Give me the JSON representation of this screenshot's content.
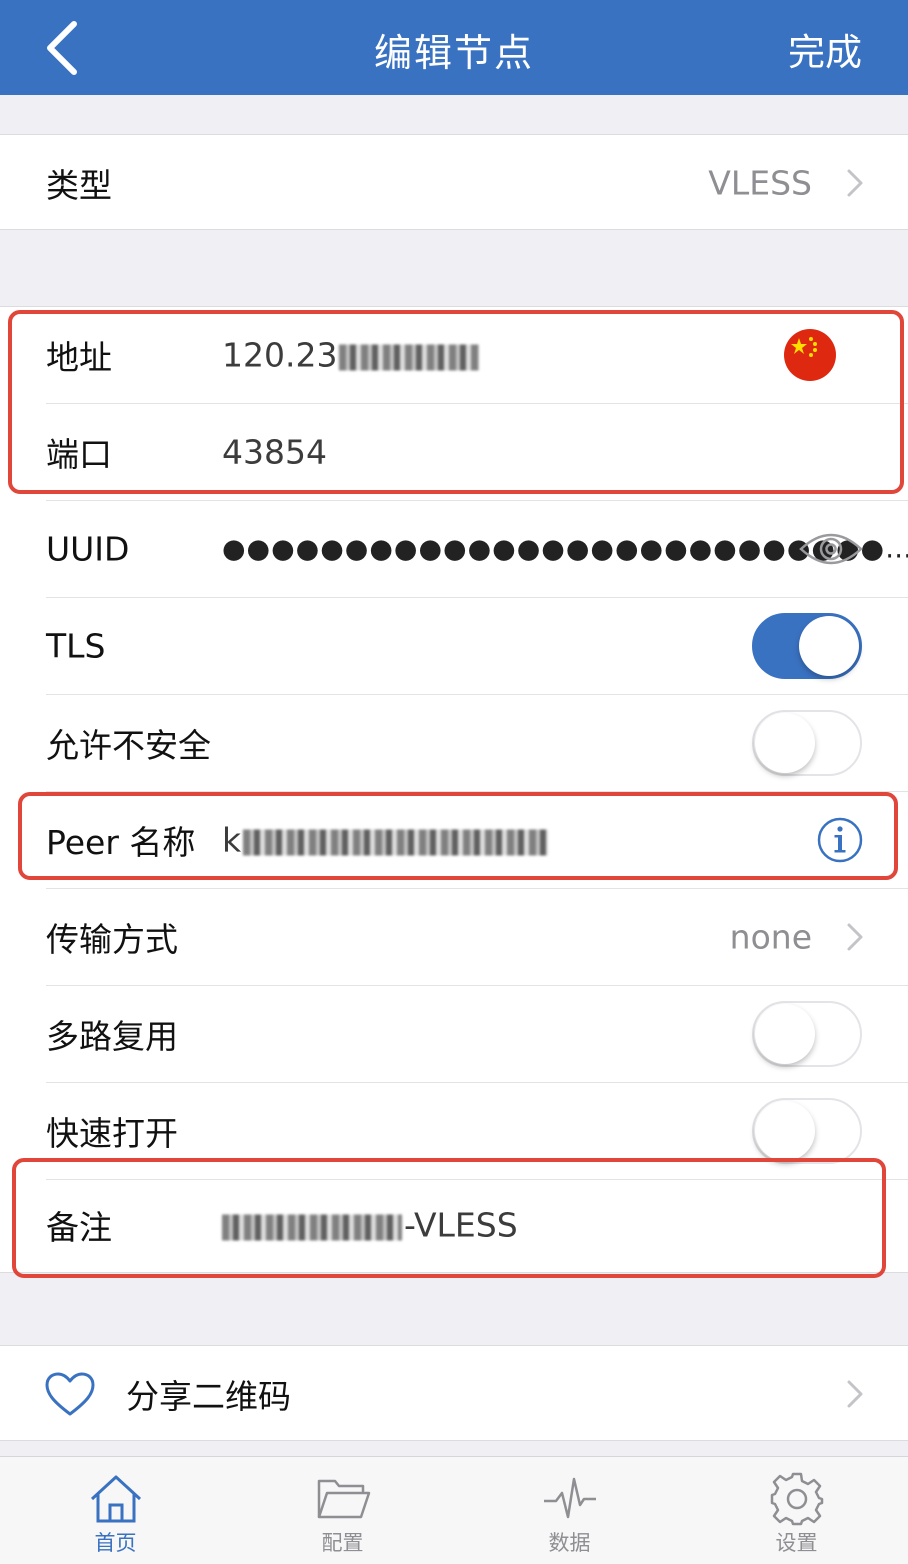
{
  "nav": {
    "title": "编辑节点",
    "done": "完成"
  },
  "type_row": {
    "label": "类型",
    "value": "VLESS"
  },
  "address": {
    "label": "地址",
    "value_visible": "120.23",
    "flag": "china-flag-icon"
  },
  "port": {
    "label": "端口",
    "value": "43854"
  },
  "uuid": {
    "label": "UUID",
    "value": "●●●●●●●●●●●●●●●●●●●●●●●●●●●…"
  },
  "tls": {
    "label": "TLS",
    "on": true
  },
  "allow_insecure": {
    "label": "允许不安全",
    "on": false
  },
  "peer": {
    "label": "Peer 名称",
    "value_visible": "k"
  },
  "transport": {
    "label": "传输方式",
    "value": "none"
  },
  "mux": {
    "label": "多路复用",
    "on": false
  },
  "fast_open": {
    "label": "快速打开",
    "on": false
  },
  "remark": {
    "label": "备注",
    "value_visible": "-VLESS"
  },
  "share": {
    "label": "分享二维码"
  },
  "tabs": [
    {
      "label": "首页",
      "icon": "home-icon",
      "active": true
    },
    {
      "label": "配置",
      "icon": "folder-icon",
      "active": false
    },
    {
      "label": "数据",
      "icon": "activity-icon",
      "active": false
    },
    {
      "label": "设置",
      "icon": "gear-icon",
      "active": false
    }
  ],
  "colors": {
    "accent": "#3a72c2",
    "highlight": "#e0463a"
  }
}
